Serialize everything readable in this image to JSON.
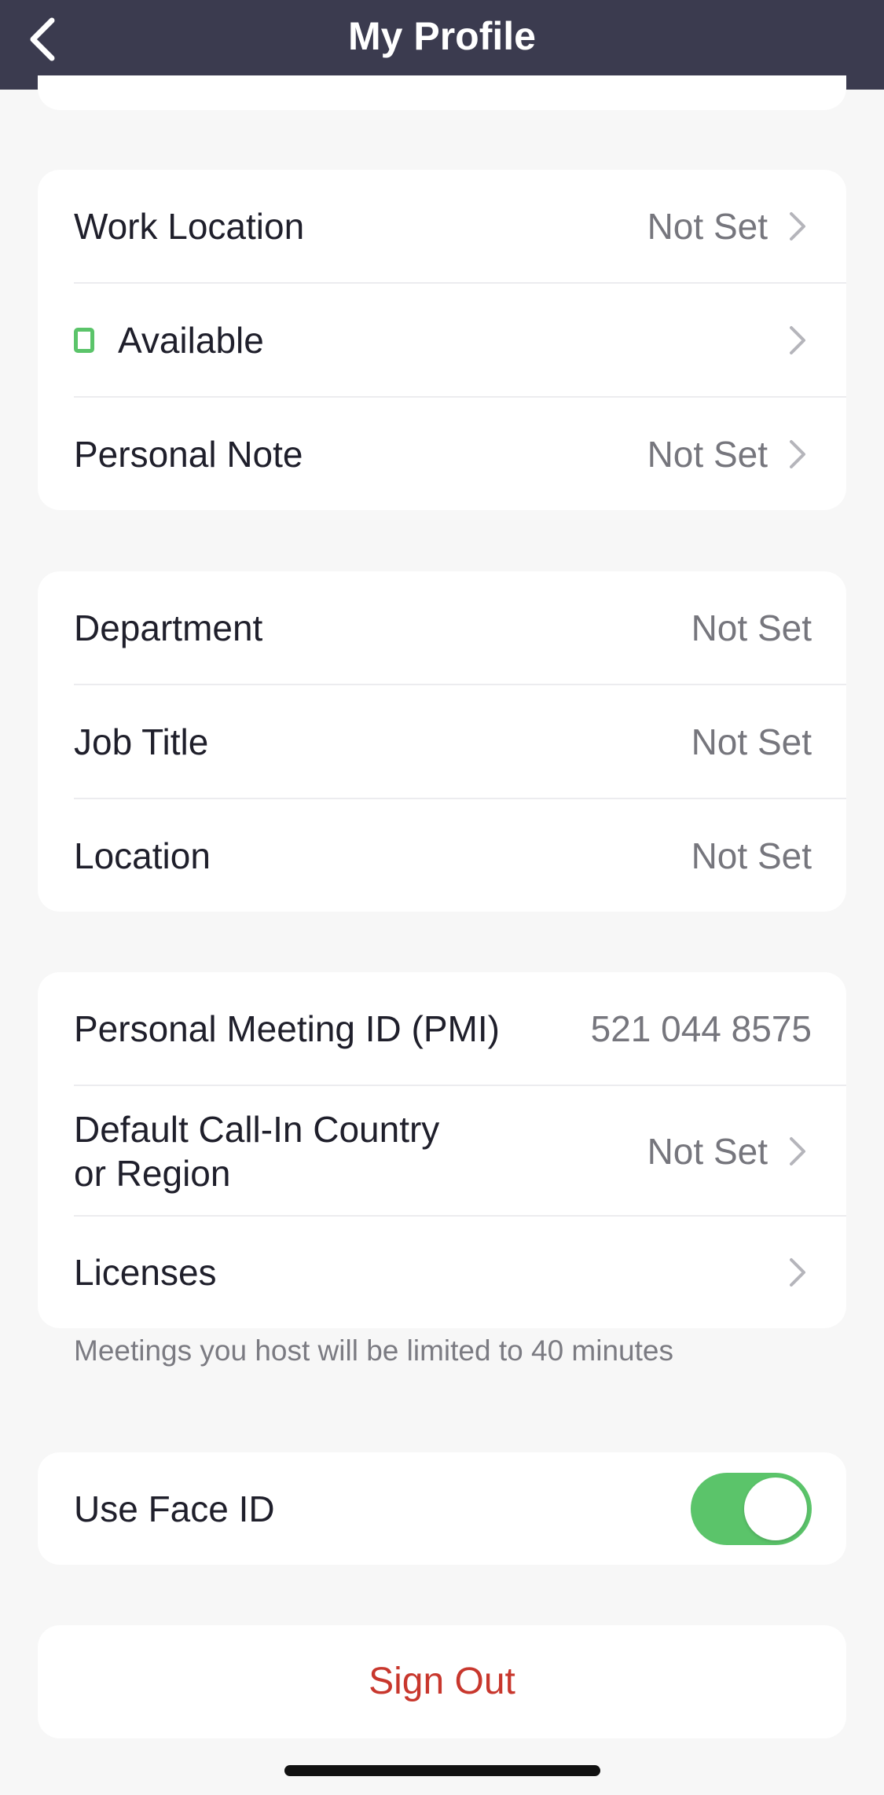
{
  "header": {
    "title": "My Profile"
  },
  "group1": {
    "work_location": {
      "label": "Work Location",
      "value": "Not Set"
    },
    "status": {
      "label": "Available",
      "color": "#5bc46a"
    },
    "personal_note": {
      "label": "Personal Note",
      "value": "Not Set"
    }
  },
  "group2": {
    "department": {
      "label": "Department",
      "value": "Not Set"
    },
    "job_title": {
      "label": "Job Title",
      "value": "Not Set"
    },
    "location": {
      "label": "Location",
      "value": "Not Set"
    }
  },
  "group3": {
    "pmi": {
      "label": "Personal Meeting ID (PMI)",
      "value": "521 044 8575"
    },
    "call_in": {
      "label_line1": "Default Call-In Country",
      "label_line2": "or Region",
      "value": "Not Set"
    },
    "licenses": {
      "label": "Licenses"
    },
    "footnote": "Meetings you host will be limited to 40 minutes"
  },
  "group4": {
    "face_id": {
      "label": "Use Face ID",
      "enabled": true
    }
  },
  "signout": {
    "label": "Sign Out"
  },
  "colors": {
    "header_bg": "#3b3b4f",
    "accent_green": "#5bc46a",
    "signout_red": "#c8372d"
  }
}
